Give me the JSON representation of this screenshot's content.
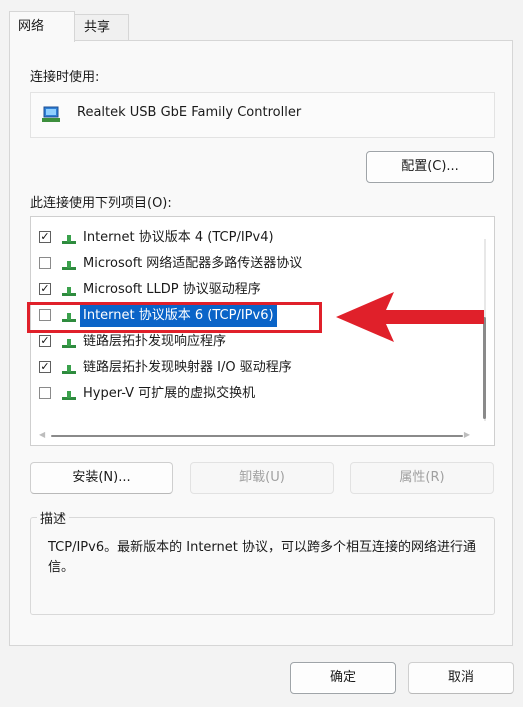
{
  "tabs": [
    {
      "label": "网络",
      "active": true
    },
    {
      "label": "共享",
      "active": false
    }
  ],
  "connect_using_label": "连接时使用:",
  "adapter": {
    "icon": "network-adapter-icon",
    "name": "Realtek USB GbE Family Controller"
  },
  "configure_button": "配置(C)...",
  "items_label": "此连接使用下列项目(O):",
  "items": [
    {
      "checked": true,
      "label": "Internet 协议版本 4 (TCP/IPv4)",
      "selected": false
    },
    {
      "checked": false,
      "label": "Microsoft 网络适配器多路传送器协议",
      "selected": false
    },
    {
      "checked": true,
      "label": "Microsoft LLDP 协议驱动程序",
      "selected": false
    },
    {
      "checked": false,
      "label": "Internet 协议版本 6 (TCP/IPv6)",
      "selected": true
    },
    {
      "checked": true,
      "label": "链路层拓扑发现响应程序",
      "selected": false
    },
    {
      "checked": true,
      "label": "链路层拓扑发现映射器 I/O 驱动程序",
      "selected": false
    },
    {
      "checked": false,
      "label": "Hyper-V 可扩展的虚拟交换机",
      "selected": false
    }
  ],
  "buttons": {
    "install": "安装(N)...",
    "uninstall": "卸载(U)",
    "properties": "属性(R)",
    "ok": "确定",
    "cancel": "取消"
  },
  "description": {
    "legend": "描述",
    "text": "TCP/IPv6。最新版本的 Internet 协议，可以跨多个相互连接的网络进行通信。"
  },
  "colors": {
    "annotation_red": "#e0202a",
    "selection_blue": "#0a64c8"
  }
}
